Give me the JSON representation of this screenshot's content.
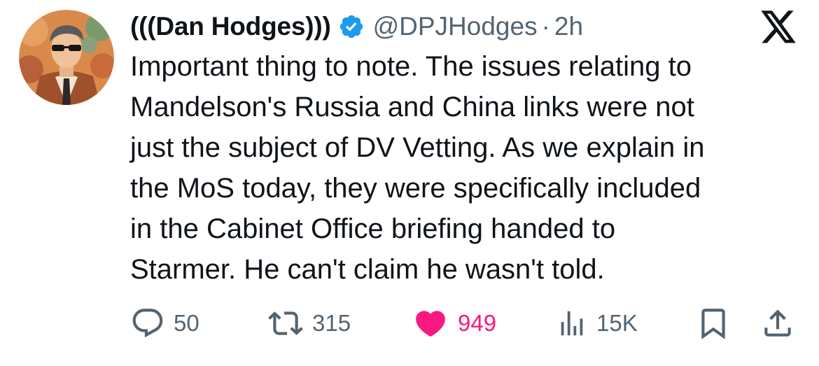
{
  "author": {
    "display_name": "(((Dan Hodges)))",
    "handle": "@DPJHodges",
    "separator": "·",
    "time_ago": "2h",
    "verified_color": "#1d9bf0"
  },
  "platform_logo": "x-logo-icon",
  "tweet_text": "Important thing to note. The issues relating to\nMandelson's Russia and China links were not\njust the subject of DV Vetting. As we explain in\nthe MoS today, they were specifically included\nin the Cabinet Office briefing handed to\nStarmer. He can't claim he wasn't told.",
  "actions": {
    "replies": "50",
    "reposts": "315",
    "likes": "949",
    "views": "15K"
  },
  "colors": {
    "text": "#0f1419",
    "secondary": "#536471",
    "like": "#f91880",
    "verified": "#1d9bf0"
  }
}
